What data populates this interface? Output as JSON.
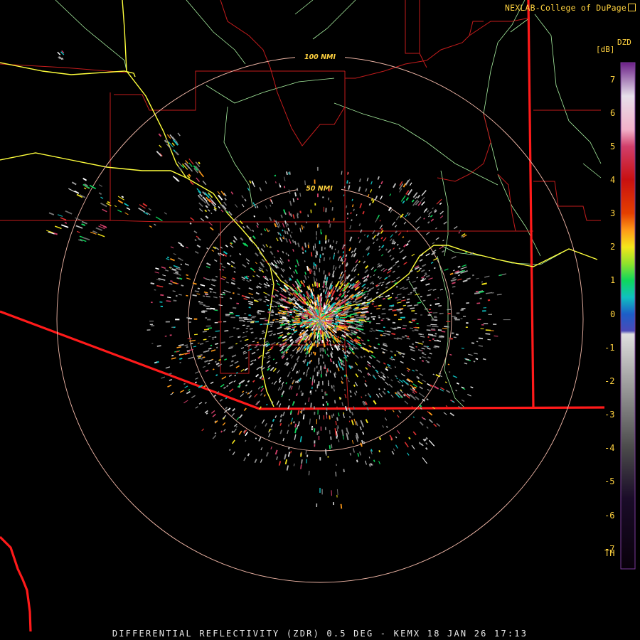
{
  "header": {
    "credit": "NEXLAB-College of DuPage"
  },
  "colorbar": {
    "product": "DZD",
    "unit": "[dB]",
    "ticks": [
      "7",
      "6",
      "5",
      "4",
      "3",
      "2",
      "1",
      "0",
      "-1",
      "-2",
      "-3",
      "-4",
      "-5",
      "-6",
      "-7",
      "TH"
    ],
    "stops": [
      {
        "v": 7.5,
        "c": "#6b1f87"
      },
      {
        "v": 6.5,
        "c": "#e6e0ea"
      },
      {
        "v": 5.5,
        "c": "#f2b0c8"
      },
      {
        "v": 5.0,
        "c": "#d13f6a"
      },
      {
        "v": 4.0,
        "c": "#c81010"
      },
      {
        "v": 3.0,
        "c": "#e44000"
      },
      {
        "v": 2.5,
        "c": "#ff9a18"
      },
      {
        "v": 2.0,
        "c": "#f4e61a"
      },
      {
        "v": 1.5,
        "c": "#8fe22c"
      },
      {
        "v": 1.0,
        "c": "#0ed65c"
      },
      {
        "v": 0.5,
        "c": "#10c0c0"
      },
      {
        "v": 0.0,
        "c": "#1c5ec8"
      },
      {
        "v": -0.5,
        "c": "#4a4ab8"
      },
      {
        "v": -0.6,
        "c": "#dedede"
      },
      {
        "v": -2.5,
        "c": "#8c8c8c"
      },
      {
        "v": -4.0,
        "c": "#4a4a4a"
      },
      {
        "v": -5.5,
        "c": "#1a0c28"
      },
      {
        "v": -7.6,
        "c": "#08000a"
      }
    ]
  },
  "map": {
    "radar_site": "KEMX",
    "range_rings": [
      {
        "label": "50 NMI",
        "nmi": 50
      },
      {
        "label": "100 NMI",
        "nmi": 100
      }
    ],
    "colors": {
      "state_border": "#ff1a1a",
      "county_border": "#c41c1c",
      "highway": "#ffff3c",
      "river": "#a8f0a0",
      "ring": "#f2b8a8"
    }
  },
  "footer": {
    "caption": "DIFFERENTIAL REFLECTIVITY (ZDR) 0.5 DEG - KEMX 18 JAN 26 17:13"
  }
}
